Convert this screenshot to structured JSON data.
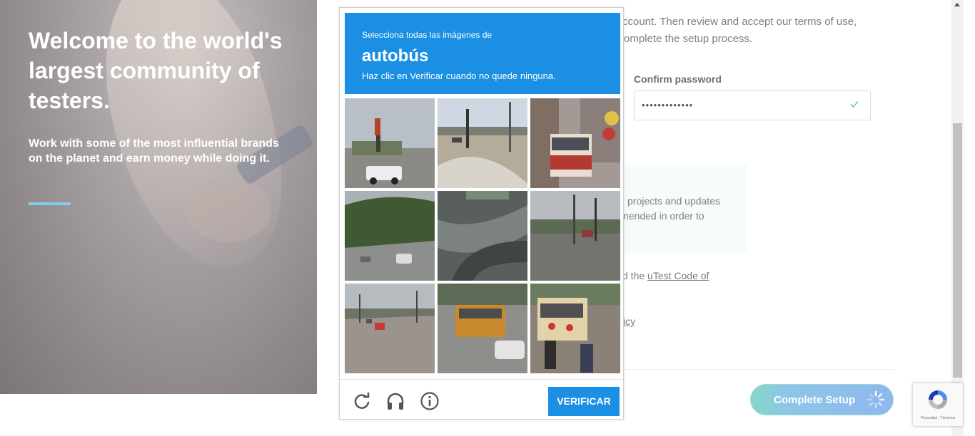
{
  "hero": {
    "title": "Welcome to the world's largest community of testers.",
    "subtitle": "Work with some of the most influential brands on the planet and earn money while doing it."
  },
  "form": {
    "intro_line1": "ccount. Then review and accept our terms of use,",
    "intro_line2": "omplete the setup process.",
    "confirm_label": "Confirm password",
    "confirm_value": "•••••••••••••",
    "info_line1": "projects and updates",
    "info_line2": "nended in order to",
    "code_prefix": "d the ",
    "code_link": "uTest Code of",
    "policy_link": "icy",
    "complete_button": "Complete Setup"
  },
  "captcha": {
    "instruction": "Selecciona todas las imágenes de",
    "target": "autobús",
    "hint": "Haz clic en Verificar cuando no quede ninguna.",
    "verify_button": "VERIFICAR",
    "tiles": [
      "street-intersection-pickup-truck",
      "road-roundabout",
      "city-street-red-bus",
      "highway-cars",
      "road-curve-aerial",
      "street-intersection-poles",
      "highway-red-car",
      "road-school-bus",
      "school-bus-people"
    ],
    "footer_icons": [
      "reload-icon",
      "audio-headphones-icon",
      "info-icon"
    ]
  },
  "recaptcha_badge": {
    "text": "Privacidad - Términos"
  },
  "colors": {
    "captcha_blue": "#1a8fe3",
    "accent_cyan": "#7fd0e6"
  }
}
